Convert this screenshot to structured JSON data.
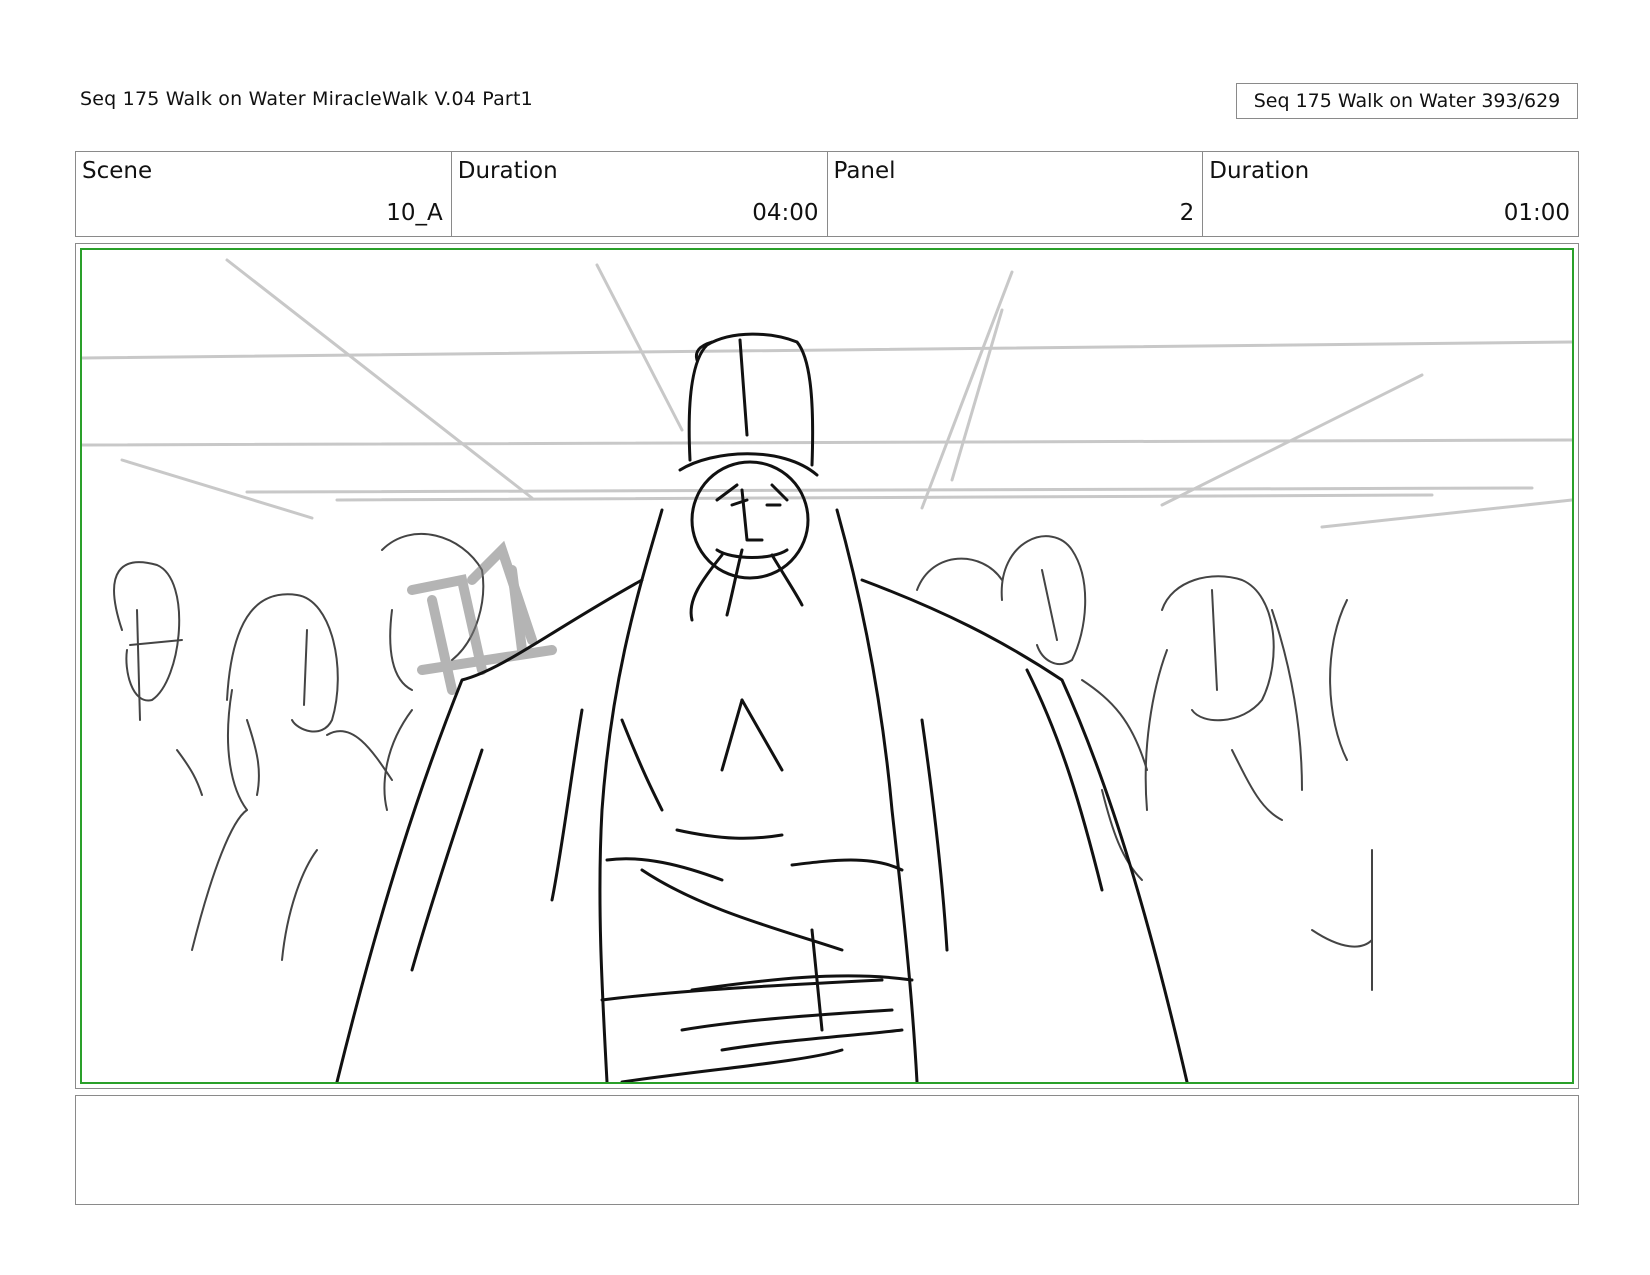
{
  "header": {
    "title": "Seq 175 Walk on Water  MiracleWalk V.04 Part1",
    "page_label": "Seq 175 Walk on Water 393/629"
  },
  "info": {
    "scene_label": "Scene",
    "scene_value": "10_A",
    "scene_duration_label": "Duration",
    "scene_duration_value": "04:00",
    "panel_label": "Panel",
    "panel_value": "2",
    "panel_duration_label": "Duration",
    "panel_duration_value": "01:00"
  },
  "panel": {
    "frame_color": "#2aa02a",
    "sketch_color": "#111111",
    "background_sketch_color": "#c8c8c8"
  },
  "notes": {
    "text": ""
  }
}
